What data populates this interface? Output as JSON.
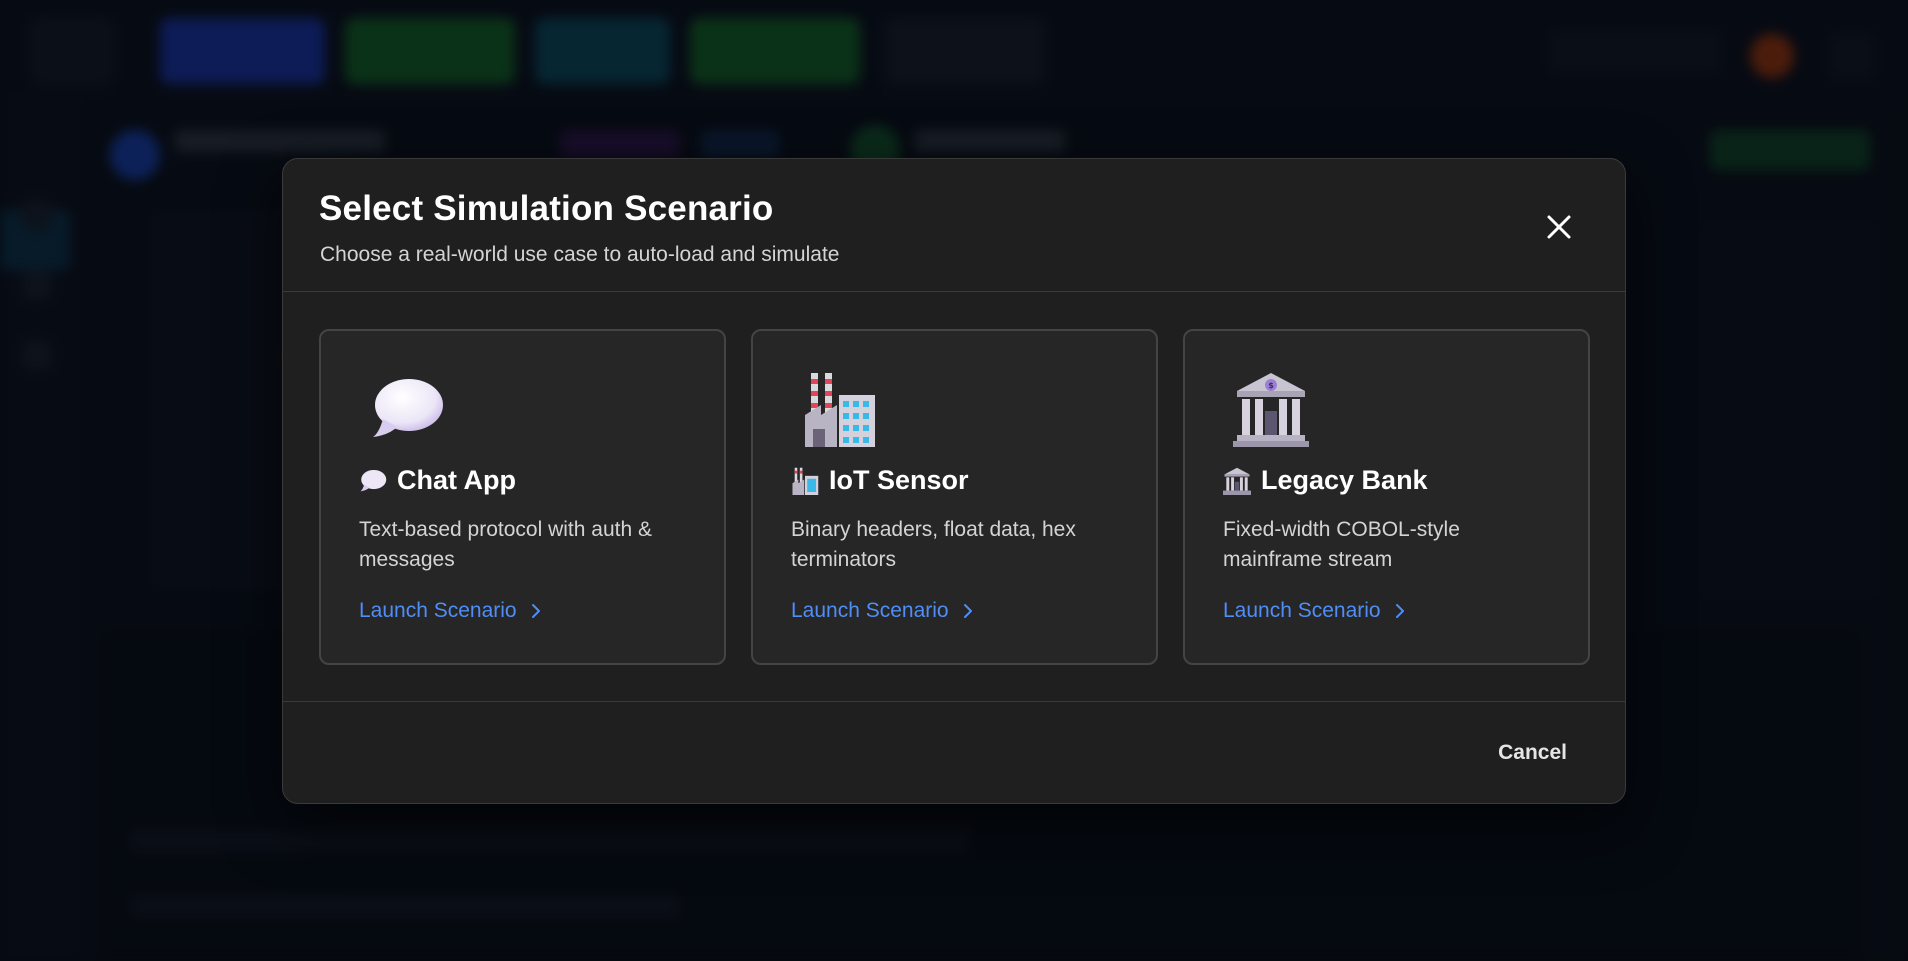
{
  "modal": {
    "title": "Select Simulation Scenario",
    "subtitle": "Choose a real-world use case to auto-load and simulate",
    "close_icon": "close-icon",
    "cancel_label": "Cancel"
  },
  "scenarios": [
    {
      "icon": "speech-bubble-icon",
      "title": "Chat App",
      "description": "Text-based protocol with auth & messages",
      "link_label": "Launch Scenario"
    },
    {
      "icon": "factory-icon",
      "title": "IoT Sensor",
      "description": "Binary headers, float data, hex terminators",
      "link_label": "Launch Scenario"
    },
    {
      "icon": "bank-icon",
      "title": "Legacy Bank",
      "description": "Fixed-width COBOL-style mainframe stream",
      "link_label": "Launch Scenario"
    }
  ],
  "colors": {
    "link": "#4f8df7",
    "modal_bg": "#1f1f1f",
    "card_bg": "#262626",
    "card_border": "#444444"
  }
}
